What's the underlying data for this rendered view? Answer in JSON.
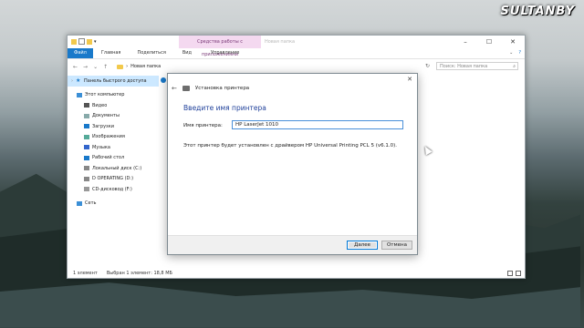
{
  "watermark": "SULTANBY",
  "explorer": {
    "contextual_tab": "Средства работы с приложениями",
    "window_title": "Новая папка",
    "ribbon_tabs": [
      "Файл",
      "Главная",
      "Поделиться",
      "Вид"
    ],
    "ribbon_manage": "Управление",
    "breadcrumb": "Новая папка",
    "search_placeholder": "Поиск: Новая папка",
    "nav_pane": {
      "quick_access": "Панель быстрого доступа",
      "items": [
        {
          "label": "Этот компьютер",
          "icon": "computer-icon"
        },
        {
          "label": "Видео",
          "icon": "video-icon"
        },
        {
          "label": "Документы",
          "icon": "documents-icon"
        },
        {
          "label": "Загрузки",
          "icon": "downloads-icon"
        },
        {
          "label": "Изображения",
          "icon": "pictures-icon"
        },
        {
          "label": "Музыка",
          "icon": "music-icon"
        },
        {
          "label": "Рабочий стол",
          "icon": "desktop-icon"
        },
        {
          "label": "Локальный диск (C:)",
          "icon": "drive-icon"
        },
        {
          "label": "D OPERATING (D:)",
          "icon": "drive-icon"
        },
        {
          "label": "CD-дисковод (F:)",
          "icon": "cd-drive-icon"
        },
        {
          "label": "Сеть",
          "icon": "network-icon"
        }
      ]
    },
    "file_chip": "up",
    "status": {
      "count": "1 элемент",
      "selected": "Выбран 1 элемент: 18,8 МБ"
    }
  },
  "dialog": {
    "title": "Установка принтера",
    "heading": "Введите имя принтера",
    "name_label": "Имя принтера:",
    "name_value": "HP LaserJet 1010",
    "info": "Этот принтер будет установлен с драйвером HP Universal Printing PCL 5 (v6.1.0).",
    "next_button": "Далее",
    "cancel_button": "Отмена"
  },
  "colors": {
    "accent": "#1979ca",
    "heading": "#1e3f9a",
    "contextual_bg": "#f4d9f0"
  }
}
